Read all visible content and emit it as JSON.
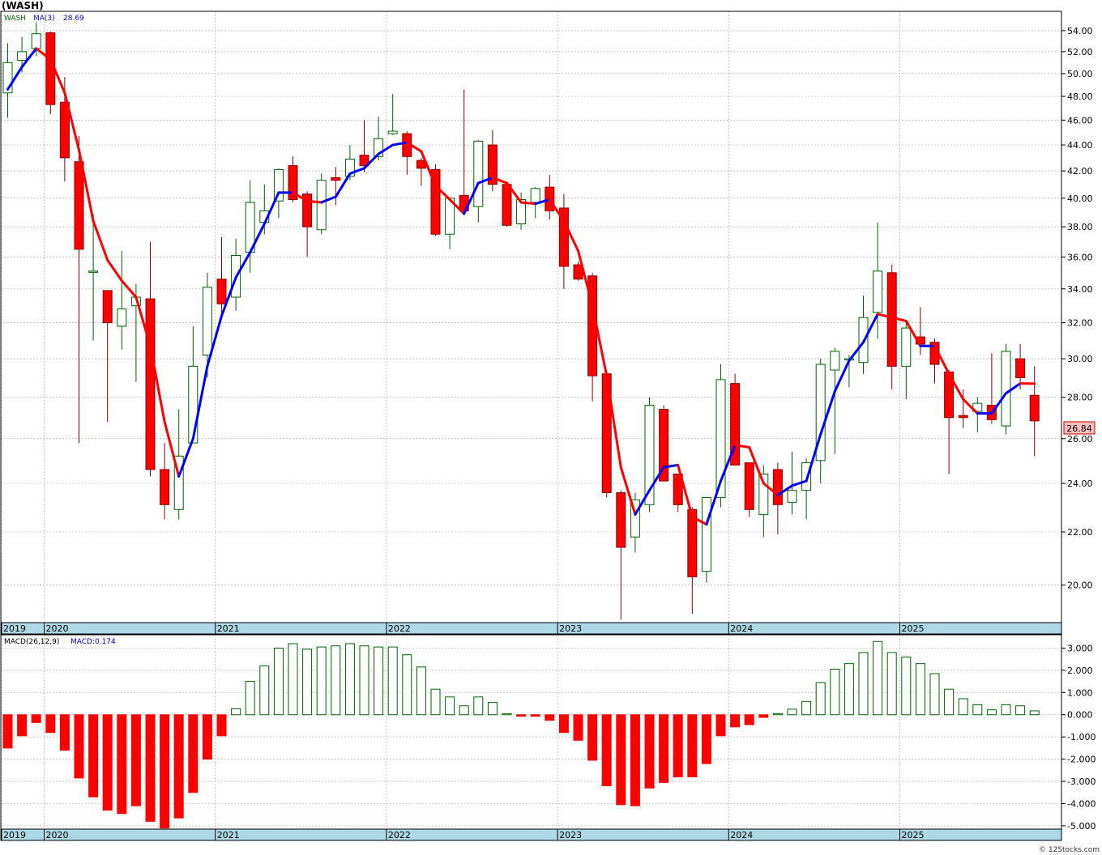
{
  "header": {
    "title": "(WASH)"
  },
  "legend_main": {
    "ticker": "WASH",
    "ma_label": "MA(3)",
    "ma_value": "28.69"
  },
  "legend_macd": {
    "label": "MACD(26,12,9)",
    "value_label": "MACD:0.174"
  },
  "last_price_label": "26.84",
  "watermark": "© 12Stocks.com",
  "colors": {
    "up_body": "#ffffff",
    "up_border": "#006400",
    "down_fill": "#ff0000",
    "down_border": "#8b0000",
    "ma_up": "#0000ff",
    "ma_down": "#ff0000",
    "macd_pos_border": "#006400",
    "macd_neg": "#ff0000",
    "axis_band": "#add8e6",
    "grid": "#b4b4b4",
    "ticker_text": "#006400",
    "ma_text": "#0000cc"
  },
  "chart_data": [
    {
      "type": "candlestick",
      "name": "price",
      "interval": "monthly",
      "x_axis_labels": [
        "2019",
        "2020",
        "2021",
        "2022",
        "2023",
        "2024",
        "2025"
      ],
      "y_ticks": [
        "20.00",
        "22.00",
        "24.00",
        "26.00",
        "28.00",
        "30.00",
        "32.00",
        "34.00",
        "36.00",
        "38.00",
        "40.00",
        "42.00",
        "44.00",
        "46.00",
        "48.00",
        "50.00",
        "52.00",
        "54.00"
      ],
      "ylim": [
        18.7,
        55.9
      ],
      "scale": "log",
      "candles": [
        {
          "t": "2019-10",
          "o": 48.3,
          "h": 52.8,
          "l": 46.2,
          "c": 51.0
        },
        {
          "t": "2019-11",
          "o": 51.2,
          "h": 53.4,
          "l": 50.1,
          "c": 52.0
        },
        {
          "t": "2019-12",
          "o": 52.3,
          "h": 54.8,
          "l": 51.6,
          "c": 53.7
        },
        {
          "t": "2020-01",
          "o": 53.8,
          "h": 53.9,
          "l": 46.5,
          "c": 47.3
        },
        {
          "t": "2020-02",
          "o": 47.5,
          "h": 49.7,
          "l": 41.2,
          "c": 43.0
        },
        {
          "t": "2020-03",
          "o": 42.7,
          "h": 44.7,
          "l": 25.8,
          "c": 36.5
        },
        {
          "t": "2020-04",
          "o": 35.1,
          "h": 38.9,
          "l": 31.0,
          "c": 35.1
        },
        {
          "t": "2020-05",
          "o": 33.9,
          "h": 33.9,
          "l": 26.8,
          "c": 32.0
        },
        {
          "t": "2020-06",
          "o": 31.8,
          "h": 36.4,
          "l": 30.5,
          "c": 32.8
        },
        {
          "t": "2020-07",
          "o": 33.0,
          "h": 34.3,
          "l": 28.8,
          "c": 33.5
        },
        {
          "t": "2020-08",
          "o": 33.4,
          "h": 37.0,
          "l": 24.3,
          "c": 24.6
        },
        {
          "t": "2020-09",
          "o": 24.6,
          "h": 25.8,
          "l": 22.5,
          "c": 23.1
        },
        {
          "t": "2020-10",
          "o": 22.9,
          "h": 27.4,
          "l": 22.5,
          "c": 25.2
        },
        {
          "t": "2020-11",
          "o": 25.8,
          "h": 31.8,
          "l": 25.8,
          "c": 29.6
        },
        {
          "t": "2020-12",
          "o": 30.2,
          "h": 35.0,
          "l": 29.0,
          "c": 34.1
        },
        {
          "t": "2021-01",
          "o": 34.6,
          "h": 37.3,
          "l": 32.5,
          "c": 33.1
        },
        {
          "t": "2021-02",
          "o": 33.5,
          "h": 37.2,
          "l": 32.7,
          "c": 36.1
        },
        {
          "t": "2021-03",
          "o": 36.3,
          "h": 41.3,
          "l": 35.0,
          "c": 39.7
        },
        {
          "t": "2021-04",
          "o": 38.3,
          "h": 41.0,
          "l": 37.5,
          "c": 39.1
        },
        {
          "t": "2021-05",
          "o": 39.8,
          "h": 42.2,
          "l": 38.6,
          "c": 42.1
        },
        {
          "t": "2021-06",
          "o": 42.4,
          "h": 43.1,
          "l": 39.7,
          "c": 39.9
        },
        {
          "t": "2021-07",
          "o": 40.3,
          "h": 40.5,
          "l": 36.0,
          "c": 38.0
        },
        {
          "t": "2021-08",
          "o": 37.8,
          "h": 41.8,
          "l": 37.5,
          "c": 41.3
        },
        {
          "t": "2021-09",
          "o": 41.5,
          "h": 42.3,
          "l": 39.5,
          "c": 41.3
        },
        {
          "t": "2021-10",
          "o": 41.6,
          "h": 44.0,
          "l": 41.3,
          "c": 42.9
        },
        {
          "t": "2021-11",
          "o": 43.2,
          "h": 46.0,
          "l": 41.9,
          "c": 42.4
        },
        {
          "t": "2021-12",
          "o": 43.1,
          "h": 46.3,
          "l": 42.8,
          "c": 44.5
        },
        {
          "t": "2022-01",
          "o": 44.9,
          "h": 48.2,
          "l": 44.8,
          "c": 45.1
        },
        {
          "t": "2022-02",
          "o": 44.9,
          "h": 45.1,
          "l": 41.7,
          "c": 43.1
        },
        {
          "t": "2022-03",
          "o": 42.8,
          "h": 43.0,
          "l": 40.9,
          "c": 42.2
        },
        {
          "t": "2022-04",
          "o": 42.1,
          "h": 42.5,
          "l": 37.4,
          "c": 37.5
        },
        {
          "t": "2022-05",
          "o": 37.5,
          "h": 40.0,
          "l": 36.5,
          "c": 40.0
        },
        {
          "t": "2022-06",
          "o": 40.2,
          "h": 48.6,
          "l": 39.0,
          "c": 39.1
        },
        {
          "t": "2022-07",
          "o": 39.4,
          "h": 44.4,
          "l": 38.3,
          "c": 44.3
        },
        {
          "t": "2022-08",
          "o": 44.0,
          "h": 45.2,
          "l": 40.5,
          "c": 41.0
        },
        {
          "t": "2022-09",
          "o": 41.0,
          "h": 41.2,
          "l": 38.0,
          "c": 38.1
        },
        {
          "t": "2022-10",
          "o": 38.2,
          "h": 40.4,
          "l": 37.8,
          "c": 39.9
        },
        {
          "t": "2022-11",
          "o": 39.7,
          "h": 40.8,
          "l": 38.6,
          "c": 40.7
        },
        {
          "t": "2022-12",
          "o": 40.8,
          "h": 41.7,
          "l": 38.5,
          "c": 39.1
        },
        {
          "t": "2023-01",
          "o": 39.3,
          "h": 40.3,
          "l": 34.0,
          "c": 35.4
        },
        {
          "t": "2023-02",
          "o": 35.5,
          "h": 35.7,
          "l": 34.5,
          "c": 34.6
        },
        {
          "t": "2023-03",
          "o": 34.8,
          "h": 35.0,
          "l": 27.8,
          "c": 29.1
        },
        {
          "t": "2023-04",
          "o": 29.2,
          "h": 29.4,
          "l": 23.4,
          "c": 23.6
        },
        {
          "t": "2023-05",
          "o": 23.6,
          "h": 23.7,
          "l": 18.8,
          "c": 21.4
        },
        {
          "t": "2023-06",
          "o": 21.8,
          "h": 23.6,
          "l": 21.2,
          "c": 23.3
        },
        {
          "t": "2023-07",
          "o": 23.1,
          "h": 28.0,
          "l": 22.8,
          "c": 27.6
        },
        {
          "t": "2023-08",
          "o": 27.4,
          "h": 27.6,
          "l": 24.6,
          "c": 24.1
        },
        {
          "t": "2023-09",
          "o": 24.4,
          "h": 24.4,
          "l": 22.8,
          "c": 23.1
        },
        {
          "t": "2023-10",
          "o": 22.9,
          "h": 23.0,
          "l": 19.0,
          "c": 20.3
        },
        {
          "t": "2023-11",
          "o": 20.5,
          "h": 23.4,
          "l": 20.1,
          "c": 23.4
        },
        {
          "t": "2023-12",
          "o": 23.4,
          "h": 29.7,
          "l": 23.0,
          "c": 28.9
        },
        {
          "t": "2024-01",
          "o": 28.7,
          "h": 29.2,
          "l": 24.8,
          "c": 24.8
        },
        {
          "t": "2024-02",
          "o": 24.9,
          "h": 24.9,
          "l": 22.6,
          "c": 22.9
        },
        {
          "t": "2024-03",
          "o": 22.7,
          "h": 24.8,
          "l": 21.8,
          "c": 24.4
        },
        {
          "t": "2024-04",
          "o": 24.6,
          "h": 24.9,
          "l": 21.9,
          "c": 23.1
        },
        {
          "t": "2024-05",
          "o": 23.2,
          "h": 25.4,
          "l": 22.7,
          "c": 23.7
        },
        {
          "t": "2024-06",
          "o": 23.7,
          "h": 25.1,
          "l": 22.5,
          "c": 24.9
        },
        {
          "t": "2024-07",
          "o": 25.0,
          "h": 30.0,
          "l": 24.0,
          "c": 29.7
        },
        {
          "t": "2024-08",
          "o": 29.4,
          "h": 30.6,
          "l": 25.3,
          "c": 30.4
        },
        {
          "t": "2024-09",
          "o": 30.0,
          "h": 30.2,
          "l": 28.5,
          "c": 30.0
        },
        {
          "t": "2024-10",
          "o": 29.8,
          "h": 33.6,
          "l": 29.2,
          "c": 32.3
        },
        {
          "t": "2024-11",
          "o": 32.6,
          "h": 38.3,
          "l": 31.1,
          "c": 35.1
        },
        {
          "t": "2024-12",
          "o": 35.0,
          "h": 35.5,
          "l": 28.4,
          "c": 29.6
        },
        {
          "t": "2025-01",
          "o": 29.6,
          "h": 32.0,
          "l": 27.9,
          "c": 31.7
        },
        {
          "t": "2025-02",
          "o": 31.2,
          "h": 32.9,
          "l": 30.2,
          "c": 30.8
        },
        {
          "t": "2025-03",
          "o": 30.9,
          "h": 31.1,
          "l": 28.7,
          "c": 29.7
        },
        {
          "t": "2025-04",
          "o": 29.3,
          "h": 29.4,
          "l": 24.4,
          "c": 27.0
        },
        {
          "t": "2025-05",
          "o": 27.1,
          "h": 28.4,
          "l": 26.5,
          "c": 27.0
        },
        {
          "t": "2025-06",
          "o": 27.3,
          "h": 28.0,
          "l": 26.3,
          "c": 27.7
        },
        {
          "t": "2025-07",
          "o": 27.6,
          "h": 30.3,
          "l": 26.7,
          "c": 26.9
        },
        {
          "t": "2025-08",
          "o": 26.6,
          "h": 30.8,
          "l": 26.2,
          "c": 30.4
        },
        {
          "t": "2025-09",
          "o": 30.0,
          "h": 30.8,
          "l": 28.4,
          "c": 29.0
        },
        {
          "t": "2025-10",
          "o": 28.1,
          "h": 29.6,
          "l": 25.2,
          "c": 26.84
        }
      ],
      "ma3": [
        48.6,
        50.6,
        52.3,
        51.3,
        48.3,
        43.6,
        38.4,
        35.8,
        34.5,
        33.5,
        30.7,
        26.8,
        24.3,
        26.0,
        29.6,
        32.4,
        34.7,
        36.3,
        38.2,
        40.4,
        40.4,
        39.8,
        39.7,
        40.1,
        41.8,
        42.2,
        43.3,
        44.0,
        44.2,
        43.5,
        40.9,
        39.9,
        38.9,
        41.1,
        41.5,
        41.1,
        39.7,
        39.6,
        39.9,
        38.4,
        36.4,
        33.0,
        29.1,
        24.7,
        22.7,
        23.7,
        24.7,
        24.8,
        22.6,
        22.3,
        24.1,
        25.7,
        25.6,
        24.0,
        23.5,
        23.9,
        24.1,
        26.2,
        28.3,
        29.9,
        30.9,
        32.5,
        32.3,
        32.1,
        30.7,
        30.7,
        29.2,
        27.9,
        27.2,
        27.2,
        28.2,
        28.7,
        28.69
      ]
    },
    {
      "type": "bar",
      "name": "macd",
      "y_ticks": [
        "-5.000",
        "-4.000",
        "-3.000",
        "-2.000",
        "-1.000",
        "0.000",
        "1.000",
        "2.000",
        "3.000"
      ],
      "ylim": [
        -5.15,
        3.6
      ],
      "values": [
        -1.5,
        -0.95,
        -0.35,
        -0.8,
        -1.6,
        -2.85,
        -3.7,
        -4.3,
        -4.45,
        -4.1,
        -4.8,
        -5.1,
        -4.65,
        -3.5,
        -2.0,
        -0.95,
        0.27,
        1.5,
        2.2,
        3.0,
        3.2,
        2.95,
        3.05,
        3.1,
        3.2,
        3.1,
        3.05,
        3.05,
        2.7,
        2.15,
        1.15,
        0.8,
        0.4,
        0.8,
        0.55,
        0.05,
        -0.07,
        -0.07,
        -0.25,
        -0.8,
        -1.15,
        -2.05,
        -3.2,
        -4.05,
        -4.1,
        -3.3,
        -3.05,
        -2.8,
        -2.8,
        -2.2,
        -0.95,
        -0.55,
        -0.45,
        -0.12,
        0.05,
        0.25,
        0.6,
        1.45,
        2.05,
        2.3,
        2.8,
        3.3,
        2.8,
        2.6,
        2.3,
        1.85,
        1.15,
        0.72,
        0.45,
        0.22,
        0.45,
        0.4,
        0.174
      ]
    }
  ]
}
